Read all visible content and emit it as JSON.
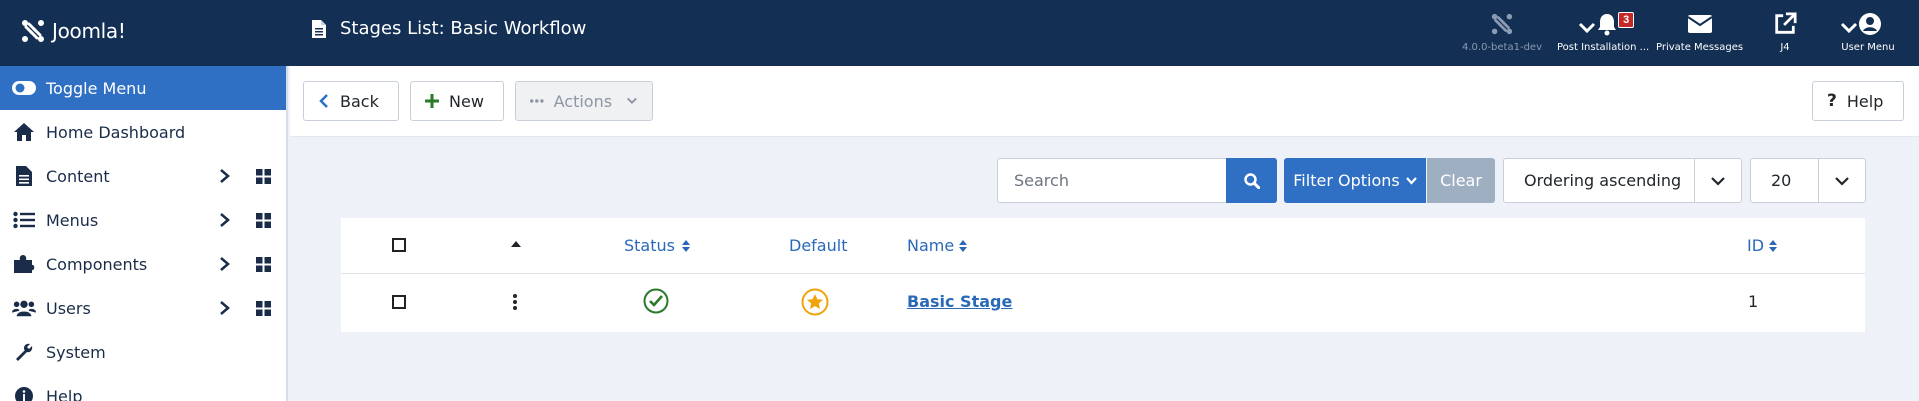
{
  "header": {
    "logo_text": "Joomla!",
    "page_title": "Stages List: Basic Workflow",
    "items": [
      {
        "label": "4.0.0-beta1-dev"
      },
      {
        "label": "Post Installation ...",
        "badge": "3"
      },
      {
        "label": "Private Messages"
      },
      {
        "label": "J4"
      },
      {
        "label": "User Menu"
      }
    ]
  },
  "sidebar": {
    "items": [
      {
        "label": "Toggle Menu"
      },
      {
        "label": "Home Dashboard"
      },
      {
        "label": "Content"
      },
      {
        "label": "Menus"
      },
      {
        "label": "Components"
      },
      {
        "label": "Users"
      },
      {
        "label": "System"
      },
      {
        "label": "Help"
      }
    ]
  },
  "toolbar": {
    "back_label": "Back",
    "new_label": "New",
    "actions_label": "Actions",
    "help_label": "Help"
  },
  "filters": {
    "search_placeholder": "Search",
    "filter_options_label": "Filter Options",
    "clear_label": "Clear",
    "ordering_value": "Ordering ascending",
    "limit_value": "20"
  },
  "table": {
    "headers": {
      "status": "Status",
      "default": "Default",
      "name": "Name",
      "id": "ID"
    },
    "rows": [
      {
        "name": "Basic Stage",
        "id": "1"
      }
    ]
  },
  "colors": {
    "header_bg": "#132f53",
    "accent": "#2f6fc4",
    "success": "#2a7a2a",
    "star": "#f0a30a"
  }
}
